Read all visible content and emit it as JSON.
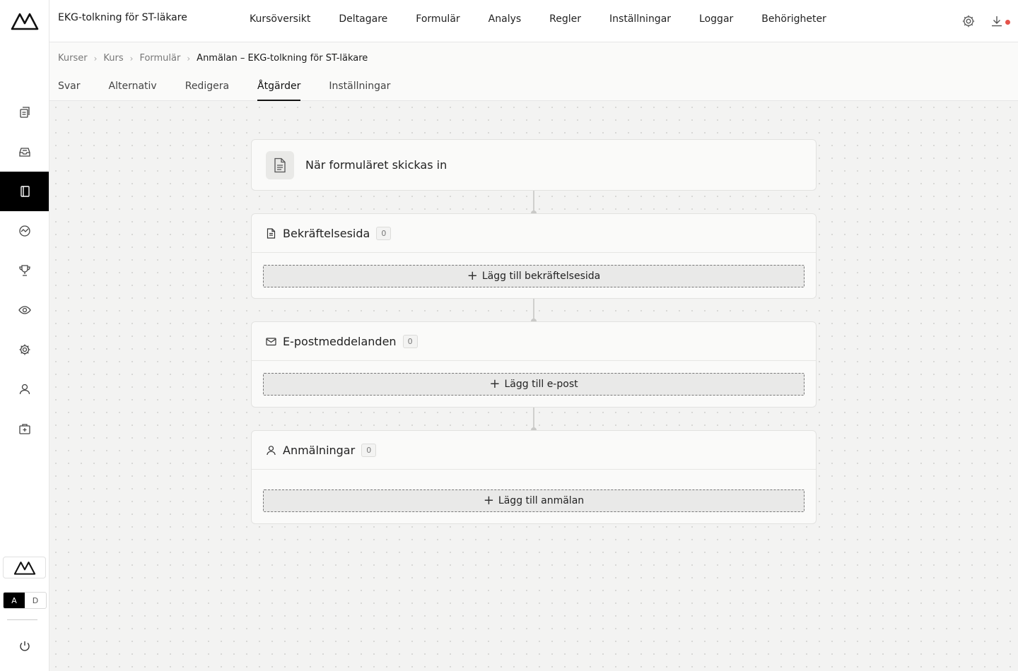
{
  "app": {
    "course_title": "EKG-tolkning för ST-läkare"
  },
  "mainnav": [
    "Kursöversikt",
    "Deltagare",
    "Formulär",
    "Analys",
    "Regler",
    "Inställningar",
    "Loggar",
    "Behörigheter"
  ],
  "breadcrumb": [
    "Kurser",
    "Kurs",
    "Formulär"
  ],
  "breadcrumb_current": "Anmälan – EKG-tolkning för ST-läkare",
  "subtabs": [
    "Svar",
    "Alternativ",
    "Redigera",
    "Åtgärder",
    "Inställningar"
  ],
  "active_subtab": "Åtgärder",
  "language": {
    "a": "A",
    "d": "D",
    "selected": "A"
  },
  "trigger": {
    "label": "När formuläret skickas in"
  },
  "sections": [
    {
      "title": "Bekräftelsesida",
      "count": "0",
      "add_label": "Lägg till bekräftelsesida",
      "icon": "document-icon"
    },
    {
      "title": "E-postmeddelanden",
      "count": "0",
      "add_label": "Lägg till e-post",
      "icon": "mail-icon"
    },
    {
      "title": "Anmälningar",
      "count": "0",
      "add_label": "Lägg till anmälan",
      "icon": "user-icon"
    }
  ],
  "rail_icons": [
    "copy-icon",
    "inbox-icon",
    "book-icon",
    "analytics-icon",
    "trophy-icon",
    "eye-icon",
    "gear-icon",
    "user-icon",
    "medkit-icon"
  ],
  "colors": {
    "active_rail": "#000000",
    "notification_dot": "#e5534b",
    "canvas_bg": "#f3f3f2"
  }
}
